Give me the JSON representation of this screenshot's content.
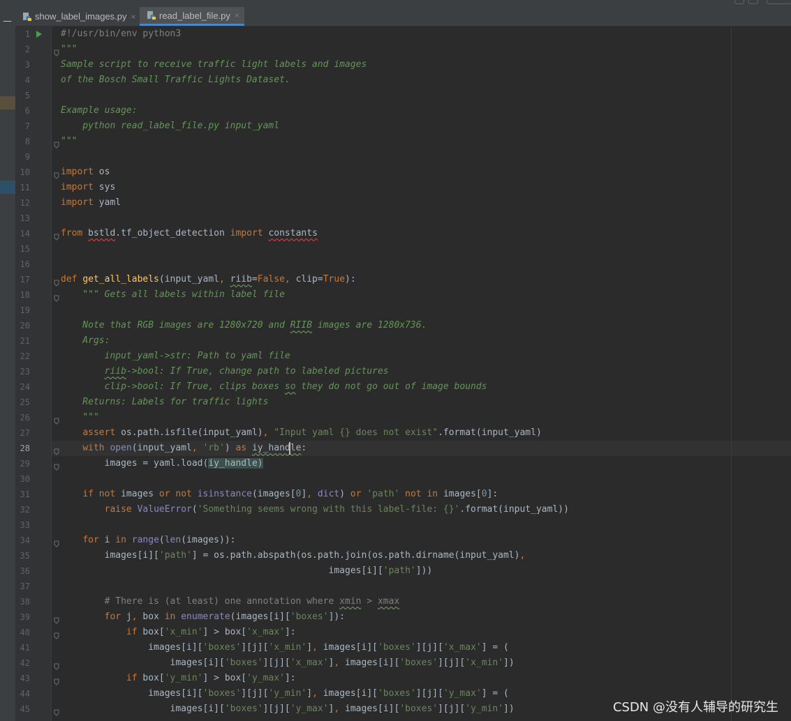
{
  "tabs": [
    {
      "label": "show_label_images.py",
      "active": false,
      "icon": "python-file-icon"
    },
    {
      "label": "read_label_file.py",
      "active": true,
      "icon": "python-file-icon"
    }
  ],
  "tab_close_glyph": "×",
  "top_strip_minus": "—",
  "current_line": 28,
  "watermark": "CSDN @没有人辅导的研究生",
  "colors": {
    "background": "#2b2b2b",
    "gutter": "#313335",
    "keyword": "#cc7832",
    "string": "#6a8759",
    "docstring": "#629755",
    "function": "#ffc66d",
    "builtin": "#8888c6",
    "number": "#6897bb",
    "default_text": "#a9b7c6",
    "tab_accent": "#4a88c7",
    "run_icon": "#499c54"
  },
  "lines": [
    {
      "n": 1,
      "fold": false,
      "run": true,
      "tokens": [
        {
          "t": "#!/usr/bin/env python3",
          "c": "cmt"
        }
      ]
    },
    {
      "n": 2,
      "fold": true,
      "tokens": [
        {
          "t": "\"\"\"",
          "c": "doc"
        }
      ]
    },
    {
      "n": 3,
      "tokens": [
        {
          "t": "Sample script to receive traffic light labels and images",
          "c": "doc"
        }
      ]
    },
    {
      "n": 4,
      "tokens": [
        {
          "t": "of the Bosch Small Traffic Lights Dataset.",
          "c": "doc"
        }
      ]
    },
    {
      "n": 5,
      "tokens": []
    },
    {
      "n": 6,
      "tokens": [
        {
          "t": "Example usage:",
          "c": "doc"
        }
      ]
    },
    {
      "n": 7,
      "tokens": [
        {
          "t": "    python read_label_file.py input_yaml",
          "c": "doc"
        }
      ]
    },
    {
      "n": 8,
      "fold": true,
      "tokens": [
        {
          "t": "\"\"\"",
          "c": "doc"
        }
      ]
    },
    {
      "n": 9,
      "tokens": []
    },
    {
      "n": 10,
      "fold": true,
      "tokens": [
        {
          "t": "import",
          "c": "kw"
        },
        {
          "t": " os"
        }
      ]
    },
    {
      "n": 11,
      "tokens": [
        {
          "t": "import",
          "c": "kw"
        },
        {
          "t": " sys"
        }
      ]
    },
    {
      "n": 12,
      "tokens": [
        {
          "t": "import",
          "c": "kw"
        },
        {
          "t": " yaml"
        }
      ]
    },
    {
      "n": 13,
      "tokens": []
    },
    {
      "n": 14,
      "fold": true,
      "tokens": [
        {
          "t": "from",
          "c": "kw"
        },
        {
          "t": " "
        },
        {
          "t": "bstld",
          "c": "squig"
        },
        {
          "t": ".tf_object_detection "
        },
        {
          "t": "import",
          "c": "kw"
        },
        {
          "t": " "
        },
        {
          "t": "constants",
          "c": "squig"
        }
      ]
    },
    {
      "n": 15,
      "tokens": []
    },
    {
      "n": 16,
      "tokens": []
    },
    {
      "n": 17,
      "fold": true,
      "tokens": [
        {
          "t": "def",
          "c": "kw"
        },
        {
          "t": " "
        },
        {
          "t": "get_all_labels",
          "c": "fn"
        },
        {
          "t": "(input_yaml"
        },
        {
          "t": ", ",
          "c": "kw"
        },
        {
          "t": "riib",
          "c": "squig-g"
        },
        {
          "t": "="
        },
        {
          "t": "False",
          "c": "kw"
        },
        {
          "t": ", ",
          "c": "kw"
        },
        {
          "t": "clip="
        },
        {
          "t": "True",
          "c": "kw"
        },
        {
          "t": "):"
        }
      ]
    },
    {
      "n": 18,
      "fold": true,
      "tokens": [
        {
          "t": "    \"\"\" Gets all labels within label file",
          "c": "doc"
        }
      ]
    },
    {
      "n": 19,
      "tokens": []
    },
    {
      "n": 20,
      "tokens": [
        {
          "t": "    Note that RGB images are 1280x720 and ",
          "c": "doc"
        },
        {
          "t": "RIIB",
          "c": "doc squig-g"
        },
        {
          "t": " images are 1280x736.",
          "c": "doc"
        }
      ]
    },
    {
      "n": 21,
      "tokens": [
        {
          "t": "    Args:",
          "c": "doc"
        }
      ]
    },
    {
      "n": 22,
      "tokens": [
        {
          "t": "        input_yaml->str: Path to yaml file",
          "c": "doc"
        }
      ]
    },
    {
      "n": 23,
      "tokens": [
        {
          "t": "        ",
          "c": "doc"
        },
        {
          "t": "riib",
          "c": "doc squig-g"
        },
        {
          "t": "->bool: If True, change path to labeled pictures",
          "c": "doc"
        }
      ]
    },
    {
      "n": 24,
      "tokens": [
        {
          "t": "        clip->bool: If True, clips boxes ",
          "c": "doc"
        },
        {
          "t": "so",
          "c": "doc squig-g"
        },
        {
          "t": " they do not go out of image bounds",
          "c": "doc"
        }
      ]
    },
    {
      "n": 25,
      "tokens": [
        {
          "t": "    Returns: Labels for traffic lights",
          "c": "doc"
        }
      ]
    },
    {
      "n": 26,
      "fold": true,
      "tokens": [
        {
          "t": "    \"\"\"",
          "c": "doc"
        }
      ]
    },
    {
      "n": 27,
      "tokens": [
        {
          "t": "    "
        },
        {
          "t": "assert",
          "c": "kw"
        },
        {
          "t": " os.path.isfile(input_yaml)"
        },
        {
          "t": ", ",
          "c": "kw"
        },
        {
          "t": "\"Input yaml {} does not exist\"",
          "c": "str"
        },
        {
          "t": ".format(input_yaml)"
        }
      ]
    },
    {
      "n": 28,
      "fold": true,
      "tokens": [
        {
          "t": "    "
        },
        {
          "t": "with",
          "c": "kw"
        },
        {
          "t": " "
        },
        {
          "t": "open",
          "c": "bi"
        },
        {
          "t": "(input_yaml"
        },
        {
          "t": ", ",
          "c": "kw"
        },
        {
          "t": "'rb'",
          "c": "str"
        },
        {
          "t": ") "
        },
        {
          "t": "as",
          "c": "kw"
        },
        {
          "t": " "
        },
        {
          "t": "iy_handle",
          "c": "squig-g"
        },
        {
          "t": ":"
        }
      ]
    },
    {
      "n": 29,
      "fold": true,
      "tokens": [
        {
          "t": "        images = yaml.load("
        },
        {
          "t": "iy_handle)",
          "c": "hl-sel"
        }
      ]
    },
    {
      "n": 30,
      "tokens": []
    },
    {
      "n": 31,
      "tokens": [
        {
          "t": "    "
        },
        {
          "t": "if not",
          "c": "kw"
        },
        {
          "t": " images "
        },
        {
          "t": "or not",
          "c": "kw"
        },
        {
          "t": " "
        },
        {
          "t": "isinstance",
          "c": "bi"
        },
        {
          "t": "(images["
        },
        {
          "t": "0",
          "c": "num"
        },
        {
          "t": "]"
        },
        {
          "t": ", ",
          "c": "kw"
        },
        {
          "t": "dict",
          "c": "bi"
        },
        {
          "t": ") "
        },
        {
          "t": "or",
          "c": "kw"
        },
        {
          "t": " "
        },
        {
          "t": "'path'",
          "c": "str"
        },
        {
          "t": " "
        },
        {
          "t": "not in",
          "c": "kw"
        },
        {
          "t": " images["
        },
        {
          "t": "0",
          "c": "num"
        },
        {
          "t": "]:"
        }
      ]
    },
    {
      "n": 32,
      "tokens": [
        {
          "t": "        "
        },
        {
          "t": "raise",
          "c": "kw"
        },
        {
          "t": " "
        },
        {
          "t": "ValueError",
          "c": "bi"
        },
        {
          "t": "("
        },
        {
          "t": "'Something seems wrong with this label-file: {}'",
          "c": "str"
        },
        {
          "t": ".format(input_yaml))"
        }
      ]
    },
    {
      "n": 33,
      "tokens": []
    },
    {
      "n": 34,
      "fold": true,
      "tokens": [
        {
          "t": "    "
        },
        {
          "t": "for",
          "c": "kw"
        },
        {
          "t": " i "
        },
        {
          "t": "in",
          "c": "kw"
        },
        {
          "t": " "
        },
        {
          "t": "range",
          "c": "bi"
        },
        {
          "t": "("
        },
        {
          "t": "len",
          "c": "bi"
        },
        {
          "t": "(images)):"
        }
      ]
    },
    {
      "n": 35,
      "tokens": [
        {
          "t": "        images[i]["
        },
        {
          "t": "'path'",
          "c": "str"
        },
        {
          "t": "] = os.path.abspath(os.path.join(os.path.dirname(input_yaml)"
        },
        {
          "t": ",",
          "c": "kw"
        }
      ]
    },
    {
      "n": 36,
      "tokens": [
        {
          "t": "                                                 images[i]["
        },
        {
          "t": "'path'",
          "c": "str"
        },
        {
          "t": "]))"
        }
      ]
    },
    {
      "n": 37,
      "tokens": []
    },
    {
      "n": 38,
      "tokens": [
        {
          "t": "        # There is (at least) one annotation where ",
          "c": "cmt"
        },
        {
          "t": "xmin",
          "c": "cmt squig-g"
        },
        {
          "t": " > ",
          "c": "cmt"
        },
        {
          "t": "xmax",
          "c": "cmt squig-g"
        }
      ]
    },
    {
      "n": 39,
      "fold": true,
      "tokens": [
        {
          "t": "        "
        },
        {
          "t": "for",
          "c": "kw"
        },
        {
          "t": " j"
        },
        {
          "t": ", ",
          "c": "kw"
        },
        {
          "t": "box "
        },
        {
          "t": "in",
          "c": "kw"
        },
        {
          "t": " "
        },
        {
          "t": "enumerate",
          "c": "bi"
        },
        {
          "t": "(images[i]["
        },
        {
          "t": "'boxes'",
          "c": "str"
        },
        {
          "t": "]):"
        }
      ]
    },
    {
      "n": 40,
      "fold": true,
      "tokens": [
        {
          "t": "            "
        },
        {
          "t": "if",
          "c": "kw"
        },
        {
          "t": " box["
        },
        {
          "t": "'x_min'",
          "c": "str"
        },
        {
          "t": "] > box["
        },
        {
          "t": "'x_max'",
          "c": "str"
        },
        {
          "t": "]:"
        }
      ]
    },
    {
      "n": 41,
      "tokens": [
        {
          "t": "                images[i]["
        },
        {
          "t": "'boxes'",
          "c": "str"
        },
        {
          "t": "][j]["
        },
        {
          "t": "'x_min'",
          "c": "str"
        },
        {
          "t": "]"
        },
        {
          "t": ", ",
          "c": "kw"
        },
        {
          "t": "images[i]["
        },
        {
          "t": "'boxes'",
          "c": "str"
        },
        {
          "t": "][j]["
        },
        {
          "t": "'x_max'",
          "c": "str"
        },
        {
          "t": "] = ("
        }
      ]
    },
    {
      "n": 42,
      "fold": true,
      "tokens": [
        {
          "t": "                    images[i]["
        },
        {
          "t": "'boxes'",
          "c": "str"
        },
        {
          "t": "][j]["
        },
        {
          "t": "'x_max'",
          "c": "str"
        },
        {
          "t": "]"
        },
        {
          "t": ", ",
          "c": "kw"
        },
        {
          "t": "images[i]["
        },
        {
          "t": "'boxes'",
          "c": "str"
        },
        {
          "t": "][j]["
        },
        {
          "t": "'x_min'",
          "c": "str"
        },
        {
          "t": "])"
        }
      ]
    },
    {
      "n": 43,
      "fold": true,
      "tokens": [
        {
          "t": "            "
        },
        {
          "t": "if",
          "c": "kw"
        },
        {
          "t": " box["
        },
        {
          "t": "'y_min'",
          "c": "str"
        },
        {
          "t": "] > box["
        },
        {
          "t": "'y_max'",
          "c": "str"
        },
        {
          "t": "]:"
        }
      ]
    },
    {
      "n": 44,
      "tokens": [
        {
          "t": "                images[i]["
        },
        {
          "t": "'boxes'",
          "c": "str"
        },
        {
          "t": "][j]["
        },
        {
          "t": "'y_min'",
          "c": "str"
        },
        {
          "t": "]"
        },
        {
          "t": ", ",
          "c": "kw"
        },
        {
          "t": "images[i]["
        },
        {
          "t": "'boxes'",
          "c": "str"
        },
        {
          "t": "][j]["
        },
        {
          "t": "'y_max'",
          "c": "str"
        },
        {
          "t": "] = ("
        }
      ]
    },
    {
      "n": 45,
      "fold": true,
      "tokens": [
        {
          "t": "                    images[i]["
        },
        {
          "t": "'boxes'",
          "c": "str"
        },
        {
          "t": "][j]["
        },
        {
          "t": "'y_max'",
          "c": "str"
        },
        {
          "t": "]"
        },
        {
          "t": ", ",
          "c": "kw"
        },
        {
          "t": "images[i]["
        },
        {
          "t": "'boxes'",
          "c": "str"
        },
        {
          "t": "][j]["
        },
        {
          "t": "'y_min'",
          "c": "str"
        },
        {
          "t": "])"
        }
      ]
    }
  ]
}
